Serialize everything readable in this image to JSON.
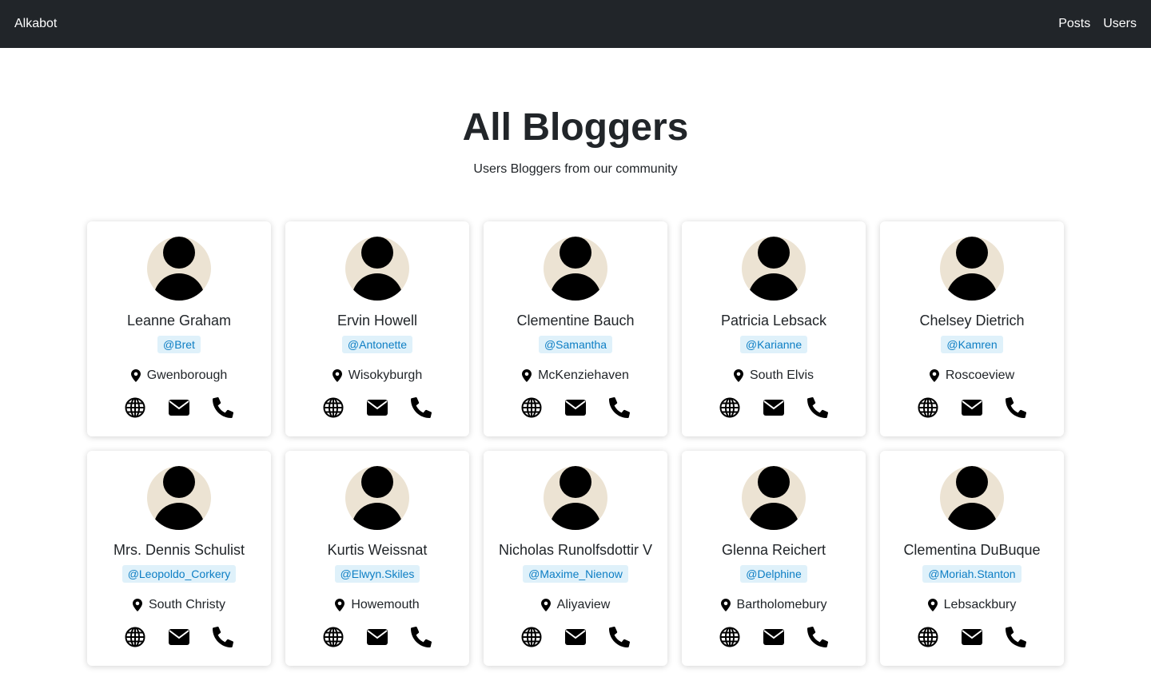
{
  "navbar": {
    "brand": "Alkabot",
    "links": [
      {
        "label": "Posts"
      },
      {
        "label": "Users"
      }
    ]
  },
  "hero": {
    "title": "All Bloggers",
    "subtitle": "Users Bloggers from our community"
  },
  "users": [
    {
      "name": "Leanne Graham",
      "username": "@Bret",
      "city": "Gwenborough"
    },
    {
      "name": "Ervin Howell",
      "username": "@Antonette",
      "city": "Wisokyburgh"
    },
    {
      "name": "Clementine Bauch",
      "username": "@Samantha",
      "city": "McKenziehaven"
    },
    {
      "name": "Patricia Lebsack",
      "username": "@Karianne",
      "city": "South Elvis"
    },
    {
      "name": "Chelsey Dietrich",
      "username": "@Kamren",
      "city": "Roscoeview"
    },
    {
      "name": "Mrs. Dennis Schulist",
      "username": "@Leopoldo_Corkery",
      "city": "South Christy"
    },
    {
      "name": "Kurtis Weissnat",
      "username": "@Elwyn.Skiles",
      "city": "Howemouth"
    },
    {
      "name": "Nicholas Runolfsdottir V",
      "username": "@Maxime_Nienow",
      "city": "Aliyaview"
    },
    {
      "name": "Glenna Reichert",
      "username": "@Delphine",
      "city": "Bartholomebury"
    },
    {
      "name": "Clementina DuBuque",
      "username": "@Moriah.Stanton",
      "city": "Lebsackbury"
    }
  ],
  "card_icons": [
    "globe-icon",
    "envelope-icon",
    "phone-icon"
  ],
  "colors": {
    "navbar_bg": "#212529",
    "avatar_bg": "#ece3d3",
    "handle_text": "#0d7ec4",
    "handle_bg": "#dff1fa"
  }
}
